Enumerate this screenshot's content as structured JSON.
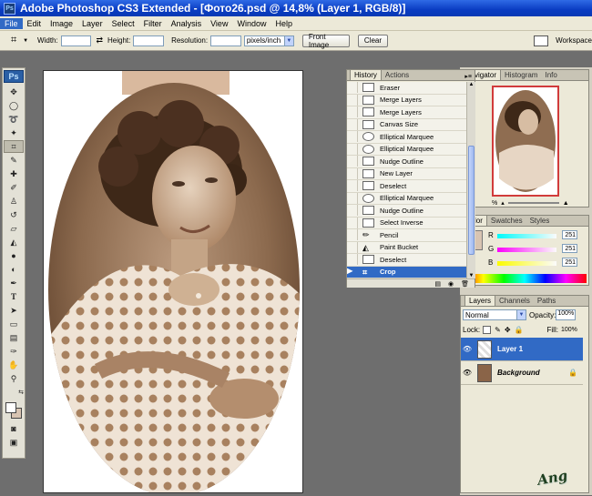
{
  "window": {
    "title": "Adobe Photoshop CS3 Extended - [Фото26.psd @ 14,8% (Layer 1, RGB/8)]",
    "app_icon": "Ps"
  },
  "menu": [
    "File",
    "Edit",
    "Image",
    "Layer",
    "Select",
    "Filter",
    "Analysis",
    "View",
    "Window",
    "Help"
  ],
  "options": {
    "width_label": "Width:",
    "height_label": "Height:",
    "resolution_label": "Resolution:",
    "units_value": "pixels/inch",
    "front_image_label": "Front Image",
    "clear_label": "Clear",
    "workspace_label": "Workspace"
  },
  "toolbox": {
    "logo": "Ps"
  },
  "history": {
    "tabs": [
      "History",
      "Actions"
    ],
    "items": [
      {
        "label": "Eraser",
        "icon": "doc-icon"
      },
      {
        "label": "Merge Layers",
        "icon": "doc-icon"
      },
      {
        "label": "Merge Layers",
        "icon": "doc-icon"
      },
      {
        "label": "Canvas Size",
        "icon": "doc-icon"
      },
      {
        "label": "Elliptical Marquee",
        "icon": "ellipse-icon"
      },
      {
        "label": "Elliptical Marquee",
        "icon": "ellipse-icon"
      },
      {
        "label": "Nudge Outline",
        "icon": "doc-icon"
      },
      {
        "label": "New Layer",
        "icon": "doc-icon"
      },
      {
        "label": "Deselect",
        "icon": "doc-icon"
      },
      {
        "label": "Elliptical Marquee",
        "icon": "ellipse-icon"
      },
      {
        "label": "Nudge Outline",
        "icon": "doc-icon"
      },
      {
        "label": "Select Inverse",
        "icon": "doc-icon"
      },
      {
        "label": "Pencil",
        "icon": "pencil-icon"
      },
      {
        "label": "Paint Bucket",
        "icon": "bucket-icon"
      },
      {
        "label": "Deselect",
        "icon": "doc-icon"
      },
      {
        "label": "Crop",
        "icon": "crop-icon"
      }
    ],
    "selected": "Crop"
  },
  "navigator": {
    "tabs": [
      "vigator",
      "Histogram",
      "Info"
    ],
    "zoom": "%"
  },
  "color": {
    "tabs": [
      "lor",
      "Swatches",
      "Styles"
    ],
    "channels": [
      {
        "label": "R",
        "value": "251"
      },
      {
        "label": "G",
        "value": "251"
      },
      {
        "label": "B",
        "value": "251"
      }
    ]
  },
  "layers": {
    "tabs": [
      "Layers",
      "Channels",
      "Paths"
    ],
    "blend_mode": "Normal",
    "opacity_label": "Opacity:",
    "opacity_value": "100%",
    "lock_label": "Lock:",
    "fill_label": "Fill:",
    "fill_value": "100%",
    "items": [
      {
        "name": "Layer 1",
        "selected": true
      },
      {
        "name": "Background",
        "selected": false
      }
    ]
  },
  "watermark": "Ang",
  "colors": {
    "accent": "#316ac5",
    "titlebar": "#0a3cc2",
    "sepia": "#8a6448"
  }
}
